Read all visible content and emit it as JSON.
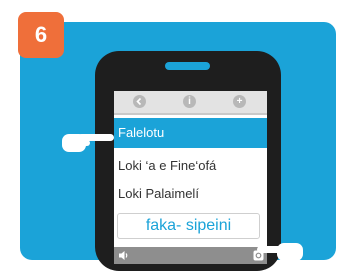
{
  "step": {
    "number": "6"
  },
  "toolbar": {
    "icons": [
      "back-icon",
      "info-icon",
      "add-icon"
    ]
  },
  "menu": {
    "items": [
      {
        "label": "Falelotu",
        "selected": true
      },
      {
        "label": "Loki ‘a e Fine‘ofá",
        "selected": false
      },
      {
        "label": "Loki Palaimelí",
        "selected": false
      }
    ]
  },
  "search": {
    "value": "faka- sipeini"
  },
  "bottom": {
    "icons": [
      "speaker-icon",
      "settings-icon"
    ]
  },
  "colors": {
    "accent": "#1ba3d8",
    "badge": "#ef6f3a",
    "phone": "#1e1e1e"
  }
}
